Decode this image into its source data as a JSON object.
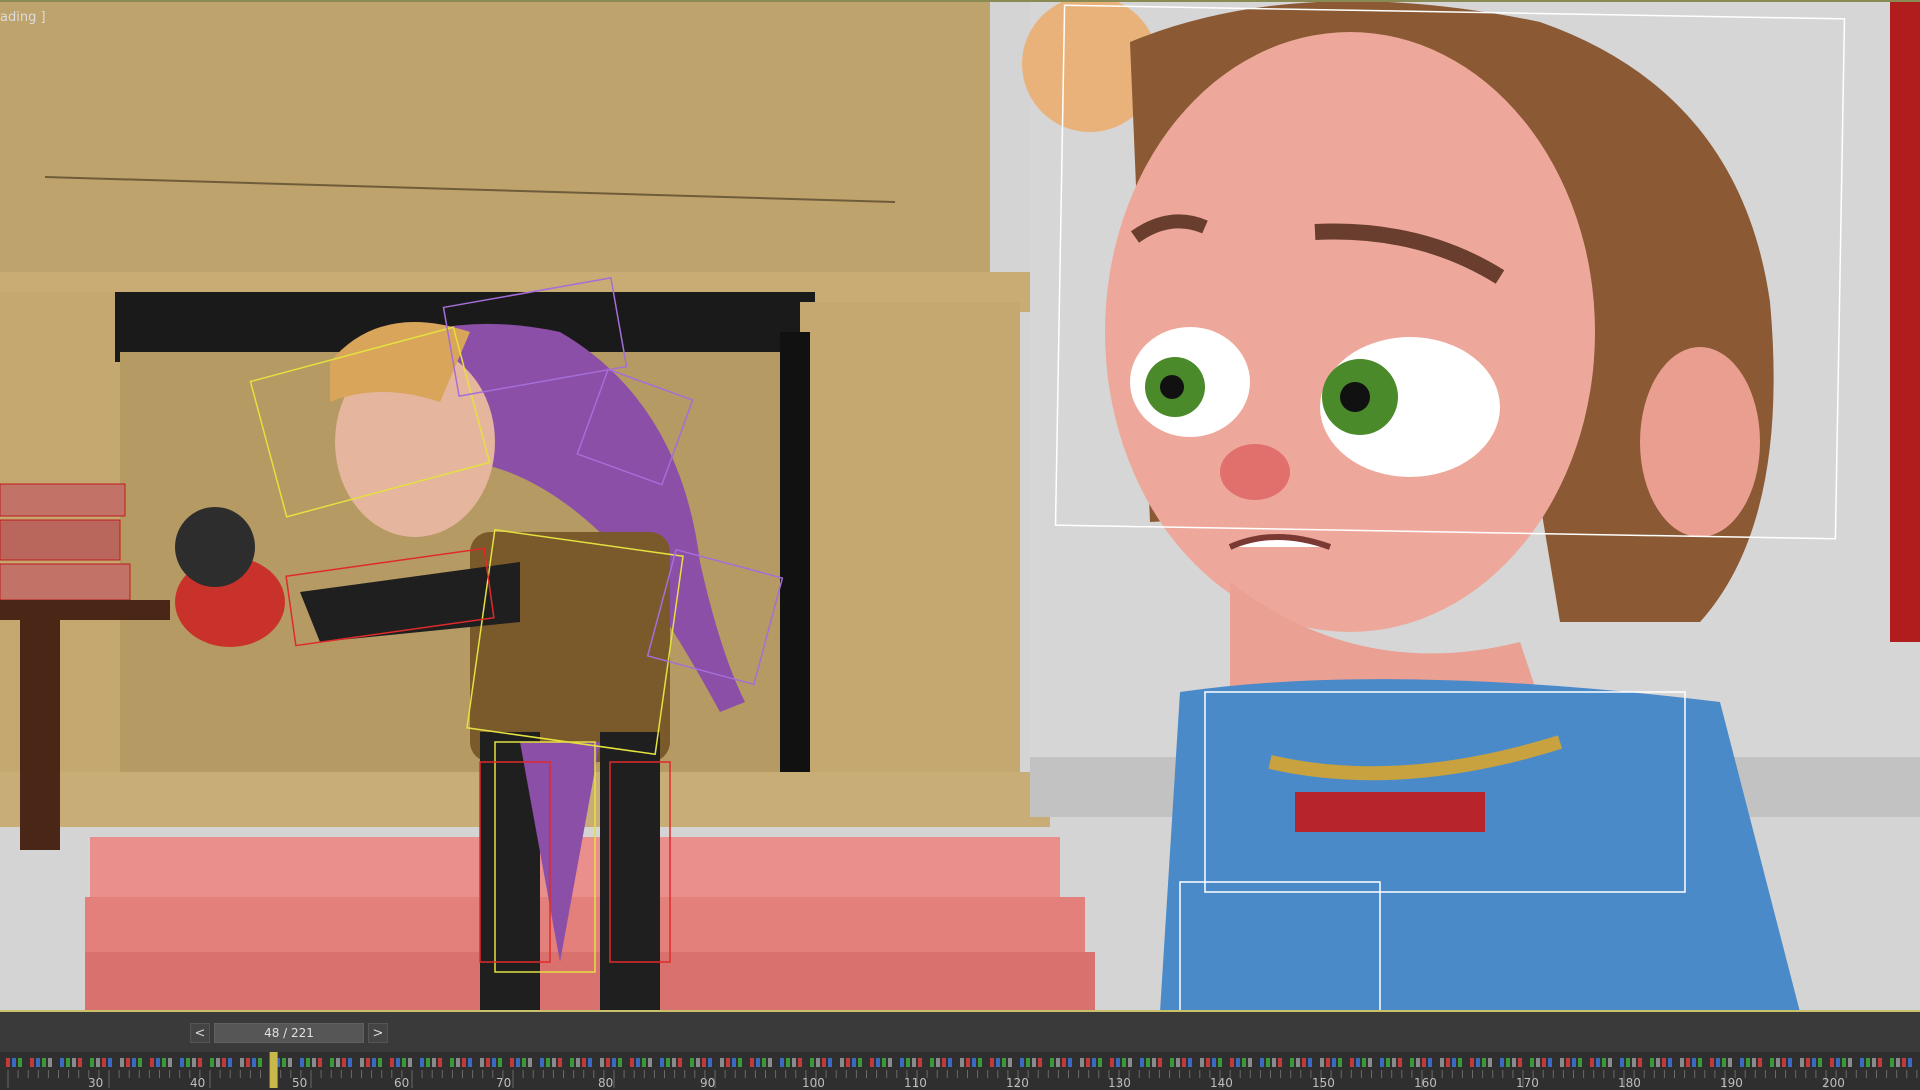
{
  "viewport": {
    "label": "ading ]"
  },
  "timeline": {
    "prev_label": "<",
    "next_label": ">",
    "frame_display": "48 / 221",
    "current_frame": 48,
    "total_frames": 221,
    "ticks": [
      "30",
      "40",
      "50",
      "60",
      "70",
      "80",
      "90",
      "100",
      "110",
      "120",
      "130",
      "140",
      "150",
      "160",
      "170",
      "180",
      "190",
      "200"
    ]
  },
  "colors": {
    "wall": "#bfa36c",
    "stage": "#e88a86",
    "floor": "#d9d9d9",
    "jester_hat": "#8c4fa8",
    "girl_dress": "#4b8ac9",
    "timeline_bg": "#3a3a3a",
    "accent": "#c9c16a"
  }
}
